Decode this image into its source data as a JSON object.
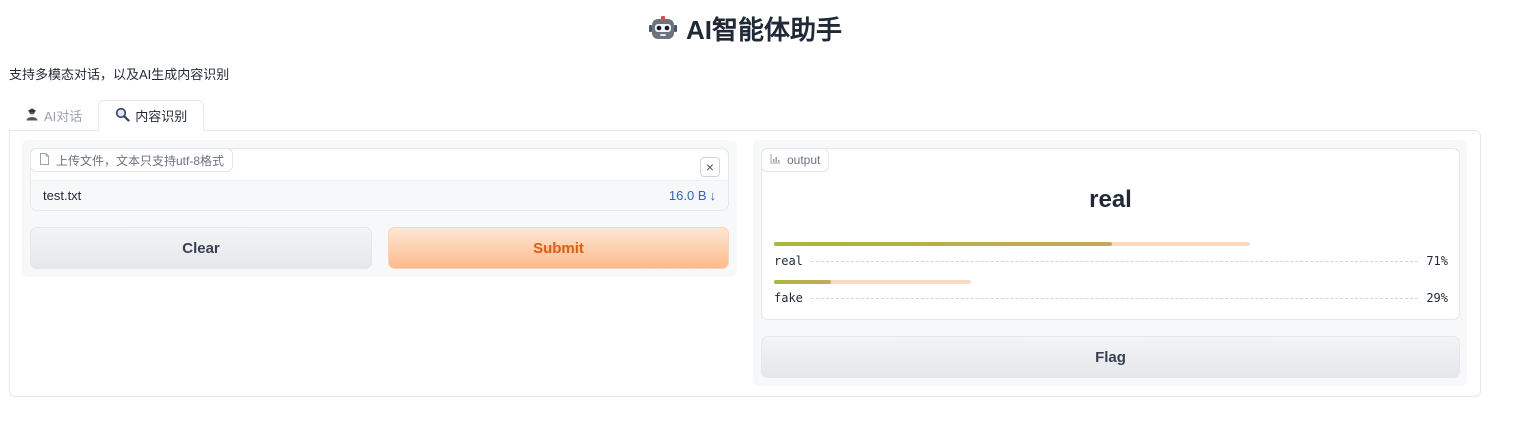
{
  "header": {
    "title": "AI智能体助手",
    "subtitle": "支持多模态对话，以及AI生成内容识别",
    "logo_icon": "robot-icon"
  },
  "tabs": [
    {
      "label": "AI对话",
      "icon": "user-icon",
      "active": false
    },
    {
      "label": "内容识别",
      "icon": "search-icon",
      "active": true
    }
  ],
  "upload": {
    "label": "上传文件，文本只支持utf-8格式",
    "file_name": "test.txt",
    "file_size": "16.0 B",
    "download_icon": "↓"
  },
  "buttons": {
    "clear": "Clear",
    "submit": "Submit",
    "flag": "Flag"
  },
  "output": {
    "label": "output",
    "top_label": "real",
    "confidences": [
      {
        "label": "real",
        "value": 0.71,
        "text": "71%"
      },
      {
        "label": "fake",
        "value": 0.29,
        "text": "29%"
      }
    ]
  },
  "colors": {
    "accent": "#ea580c",
    "link": "#2563eb"
  }
}
